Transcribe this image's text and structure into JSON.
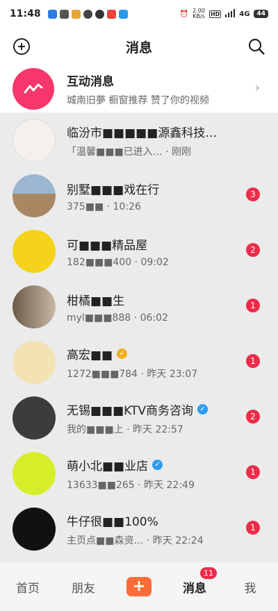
{
  "status_bar": {
    "time": "11:48",
    "net_speed_value": "2.00",
    "net_speed_unit": "KB/s",
    "network": "4G",
    "battery": "44"
  },
  "header": {
    "title": "消息"
  },
  "interaction": {
    "title": "互动消息",
    "subtitle": "城南旧夢 橱窗推荐 赞了你的视频"
  },
  "conversations": [
    {
      "name": "临汾市■■■■■源鑫科技…",
      "preview": "「温馨■■■已进入… · 刚刚",
      "unread": "",
      "verified": false
    },
    {
      "name": "别墅■■■戏在行",
      "preview": "375■■ · 10:26",
      "unread": "3",
      "verified": false
    },
    {
      "name": "可■■■精品屋",
      "preview": "182■■■400 · 09:02",
      "unread": "2",
      "verified": false
    },
    {
      "name": "柑橘■■生",
      "preview": "myl■■■888 · 06:02",
      "unread": "1",
      "verified": false
    },
    {
      "name": "高宏■■",
      "preview": "1272■■■784 · 昨天 23:07",
      "unread": "1",
      "verified": true,
      "verified_color": "#f2b01e"
    },
    {
      "name": "无锡■■■KTV商务咨询",
      "preview": "我的■■■上 · 昨天 22:57",
      "unread": "2",
      "verified": true,
      "verified_color": "#2d9cf0"
    },
    {
      "name": "萌小北■■业店",
      "preview": "13633■■265 · 昨天 22:49",
      "unread": "1",
      "verified": true,
      "verified_color": "#2d9cf0"
    },
    {
      "name": "牛仔很■■100%",
      "preview": "主页点■■森资… · 昨天 22:24",
      "unread": "1",
      "verified": false
    }
  ],
  "tabbar": {
    "home": "首页",
    "friends": "朋友",
    "add": "+",
    "messages": "消息",
    "messages_badge": "11",
    "me": "我"
  },
  "colors": {
    "accent": "#ee2c4a",
    "interaction_icon": "#f7366b",
    "add_button": "#fc6c38"
  }
}
